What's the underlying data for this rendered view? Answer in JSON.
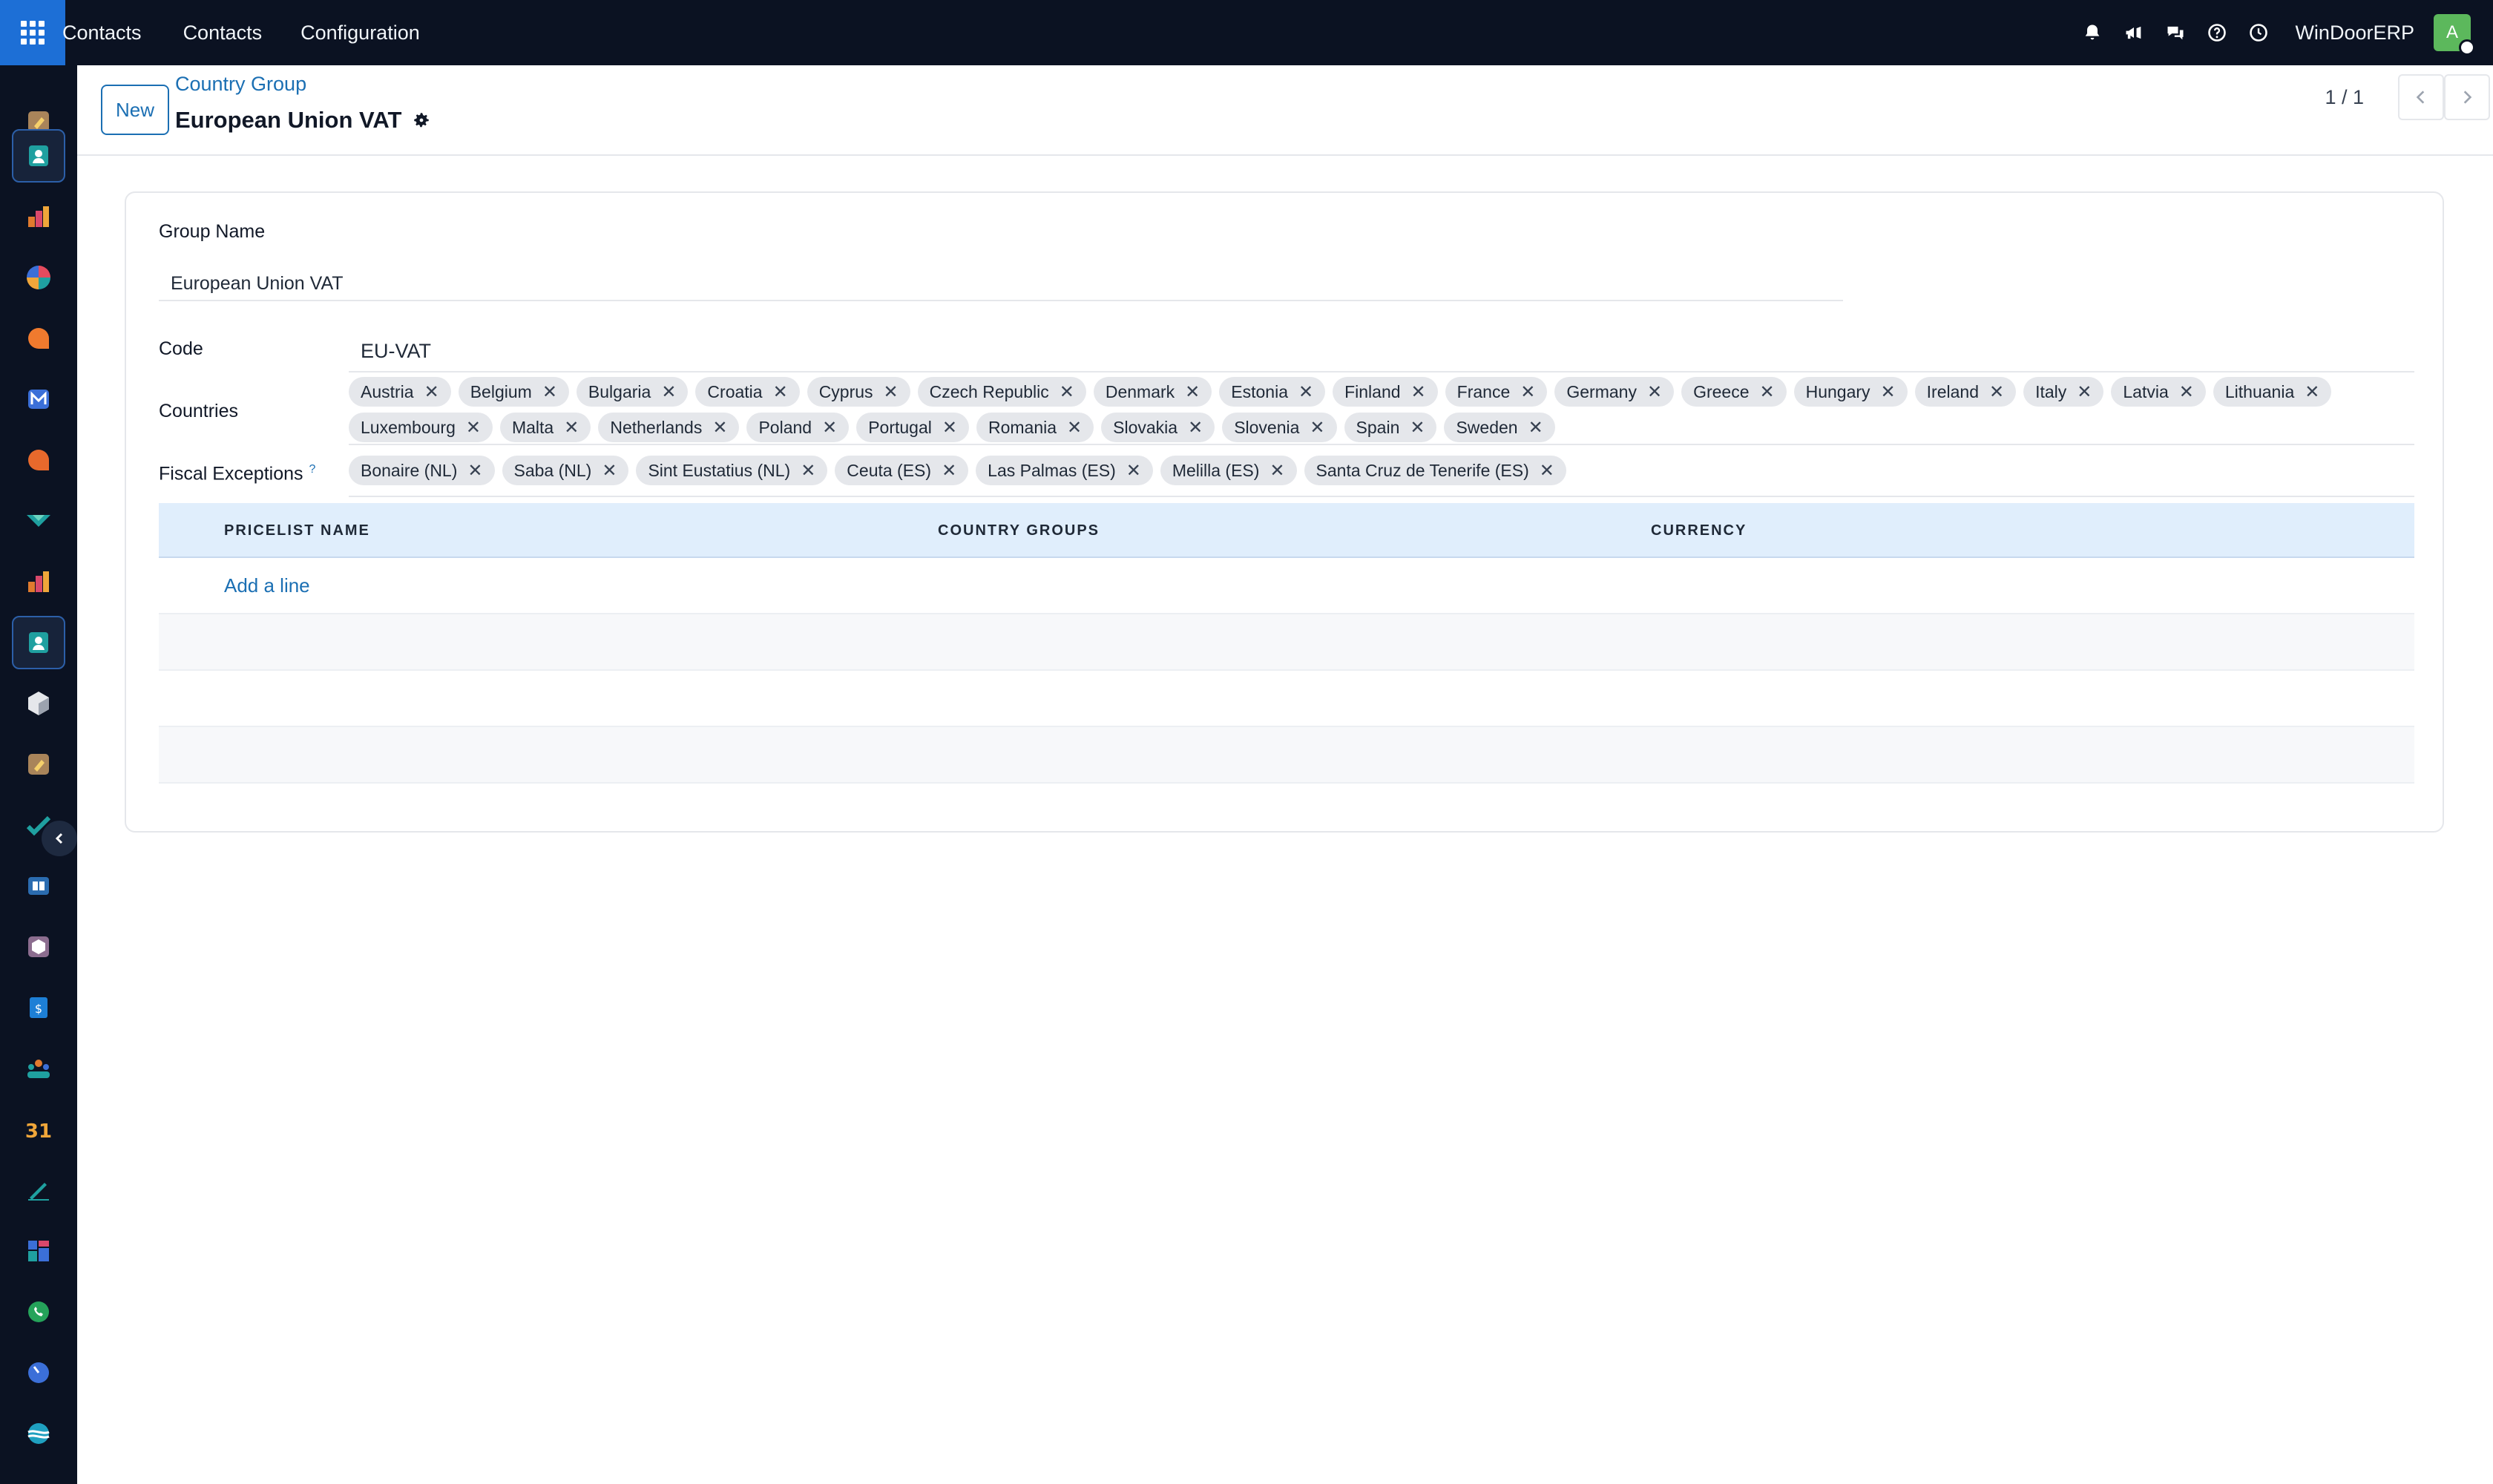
{
  "topbar": {
    "app_title": "Contacts",
    "menu": [
      "Contacts",
      "Configuration"
    ],
    "company": "WinDoorERP",
    "avatar_initial": "A",
    "icons": [
      "bell-icon",
      "megaphone-icon",
      "chat-icon",
      "help-icon",
      "clock-icon"
    ]
  },
  "sidebar": {
    "apps": [
      {
        "icon": "dashboard-app-icon",
        "active": false
      },
      {
        "icon": "contacts-app-icon",
        "active": true
      },
      {
        "icon": "bar-chart-app-icon",
        "active": false
      },
      {
        "icon": "pie-chart-app-icon",
        "active": false
      },
      {
        "icon": "discuss-app-icon",
        "active": false
      },
      {
        "icon": "mail-app-icon",
        "active": false
      },
      {
        "icon": "livechat-app-icon",
        "active": false
      },
      {
        "icon": "helpdesk-app-icon",
        "active": false
      },
      {
        "icon": "reporting-app-icon",
        "active": false
      },
      {
        "icon": "contacts-app-icon",
        "active": true
      },
      {
        "icon": "inventory-app-icon",
        "active": false
      },
      {
        "icon": "settings-app-icon",
        "active": false
      },
      {
        "icon": "todo-app-icon",
        "active": false
      },
      {
        "icon": "knowledge-app-icon",
        "active": false
      },
      {
        "icon": "barcode-app-icon",
        "active": false
      },
      {
        "icon": "invoicing-app-icon",
        "active": false
      },
      {
        "icon": "employees-app-icon",
        "active": false
      },
      {
        "icon": "calendar-app-icon",
        "active": false
      },
      {
        "icon": "sign-app-icon",
        "active": false
      },
      {
        "icon": "apps-app-icon",
        "active": false
      },
      {
        "icon": "whatsapp-app-icon",
        "active": false
      },
      {
        "icon": "timer-app-icon",
        "active": false
      },
      {
        "icon": "website-app-icon",
        "active": false
      }
    ]
  },
  "control": {
    "new_label": "New",
    "breadcrumb": "Country Group",
    "record_title": "European Union VAT",
    "pager": "1 / 1"
  },
  "form": {
    "group_name_label": "Group Name",
    "group_name_value": "European Union VAT",
    "code_label": "Code",
    "code_value": "EU-VAT",
    "countries_label": "Countries",
    "countries_row1": [
      "Austria",
      "Belgium",
      "Bulgaria",
      "Croatia",
      "Cyprus",
      "Czech Republic",
      "Denmark",
      "Estonia",
      "Finland",
      "France",
      "Germany",
      "Greece",
      "Hungary",
      "Ireland",
      "Italy",
      "Latvia",
      "Lithuania"
    ],
    "countries_row2": [
      "Luxembourg",
      "Malta",
      "Netherlands",
      "Poland",
      "Portugal",
      "Romania",
      "Slovakia",
      "Slovenia",
      "Spain",
      "Sweden"
    ],
    "fiscal_label": "Fiscal Exceptions",
    "fiscal_help": "?",
    "fiscal_exceptions": [
      "Bonaire (NL)",
      "Saba (NL)",
      "Sint Eustatius (NL)",
      "Ceuta (ES)",
      "Las Palmas (ES)",
      "Melilla (ES)",
      "Santa Cruz de Tenerife (ES)"
    ],
    "tag_remove_glyph": "✕"
  },
  "table": {
    "columns": [
      "PRICELIST NAME",
      "COUNTRY GROUPS",
      "CURRENCY"
    ],
    "add_line": "Add a line"
  },
  "colors": {
    "navbar": "#0b1222",
    "accent": "#1b6fb3",
    "apps_button": "#1d6fd6",
    "table_header": "#e0eefc",
    "avatar": "#5cb85c"
  }
}
